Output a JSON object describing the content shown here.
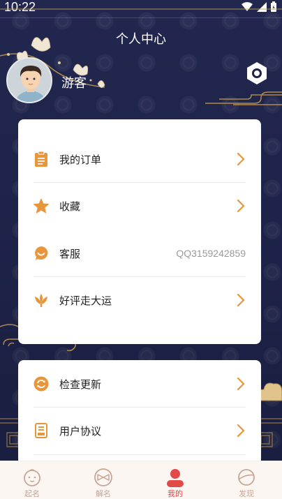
{
  "status_bar": {
    "time": "10:22"
  },
  "header": {
    "title": "个人中心"
  },
  "profile": {
    "username": "游客"
  },
  "menu_main": [
    {
      "label": "我的订单",
      "icon": "clipboard-icon"
    },
    {
      "label": "收藏",
      "icon": "star-icon"
    },
    {
      "label": "客服",
      "icon": "chat-icon",
      "value": "QQ3159242859"
    },
    {
      "label": "好评走大运",
      "icon": "lotus-icon"
    }
  ],
  "menu_secondary": [
    {
      "label": "检查更新",
      "icon": "refresh-icon"
    },
    {
      "label": "用户协议",
      "icon": "document-icon"
    }
  ],
  "tabs": [
    {
      "label": "起名",
      "icon": "baby-face-icon"
    },
    {
      "label": "解名",
      "icon": "bowtie-icon"
    },
    {
      "label": "我的",
      "icon": "person-icon",
      "active": true
    },
    {
      "label": "发现",
      "icon": "planet-icon"
    }
  ],
  "colors": {
    "accent": "#e8963a",
    "active_tab": "#e24a4a",
    "header_bg": "#1f2346"
  }
}
